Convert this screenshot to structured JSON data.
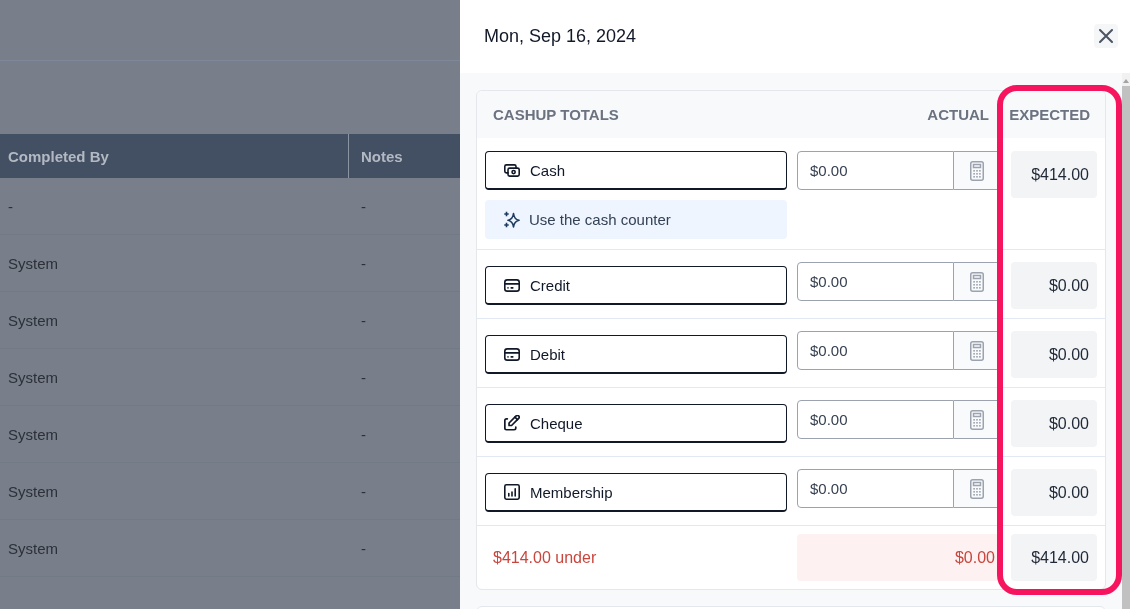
{
  "backdrop": {
    "columns": [
      "Completed By",
      "Notes"
    ],
    "rows": [
      [
        "-",
        "-"
      ],
      [
        "System",
        "-"
      ],
      [
        "System",
        "-"
      ],
      [
        "System",
        "-"
      ],
      [
        "System",
        "-"
      ],
      [
        "System",
        "-"
      ],
      [
        "System",
        "-"
      ]
    ]
  },
  "drawer": {
    "title": "Mon, Sep 16, 2024",
    "cashup": {
      "heading": "CASHUP TOTALS",
      "actual_heading": "ACTUAL",
      "expected_heading": "EXPECTED",
      "methods": [
        {
          "kind": "cash",
          "label": "Cash",
          "actual": "$0.00",
          "expected": "$414.00",
          "helper": "Use the cash counter"
        },
        {
          "kind": "card",
          "label": "Credit",
          "actual": "$0.00",
          "expected": "$0.00"
        },
        {
          "kind": "card",
          "label": "Debit",
          "actual": "$0.00",
          "expected": "$0.00"
        },
        {
          "kind": "cheque",
          "label": "Cheque",
          "actual": "$0.00",
          "expected": "$0.00"
        },
        {
          "kind": "membership",
          "label": "Membership",
          "actual": "$0.00",
          "expected": "$0.00"
        }
      ],
      "summary": {
        "variance": "$414.00 under",
        "shortfall": true,
        "actual_total": "$0.00",
        "expected_total": "$414.00"
      }
    }
  }
}
